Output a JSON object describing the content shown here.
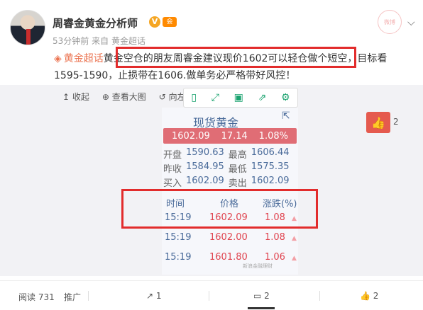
{
  "post": {
    "username": "周睿金黄金分析师",
    "badge_v": "V",
    "member_badge": "会",
    "meta_time": "53分钟前",
    "meta_from": "来自",
    "meta_source": "黄金超话",
    "text_topic": "黄金超话",
    "text_main": "黄金空仓的朋友周睿金建议现价1602可以轻仓做个短空，目标看1595-1590，止损带在1606.做单务必严格带好风控！",
    "stamp_text": "微博"
  },
  "media": {
    "collapse_label": "收起",
    "view_large_label": "查看大图",
    "rotate_left_label": "向左"
  },
  "quote": {
    "title": "现货黄金",
    "price": "1602.09",
    "change": "17.14",
    "change_pct": "1.08%",
    "open_label": "开盘",
    "open": "1590.63",
    "high_label": "最高",
    "high": "1606.44",
    "prev_label": "昨收",
    "prev": "1584.95",
    "low_label": "最低",
    "low": "1575.35",
    "buy_label": "买入",
    "buy": "1602.09",
    "sell_label": "卖出",
    "sell": "1602.09",
    "headers": [
      "时间",
      "价格",
      "涨跌(%)"
    ],
    "rows": [
      {
        "time": "15:19",
        "price": "1602.09",
        "change": "1.08"
      },
      {
        "time": "15:19",
        "price": "1602.00",
        "change": "1.08"
      },
      {
        "time": "15:19",
        "price": "1601.80",
        "change": "1.06"
      }
    ],
    "watermark": "新浪金融理财"
  },
  "side": {
    "like_count": "2"
  },
  "footer": {
    "read": "阅读 731",
    "promote": "推广",
    "repost_count": "1",
    "comment_count": "2",
    "like_count": "2"
  }
}
